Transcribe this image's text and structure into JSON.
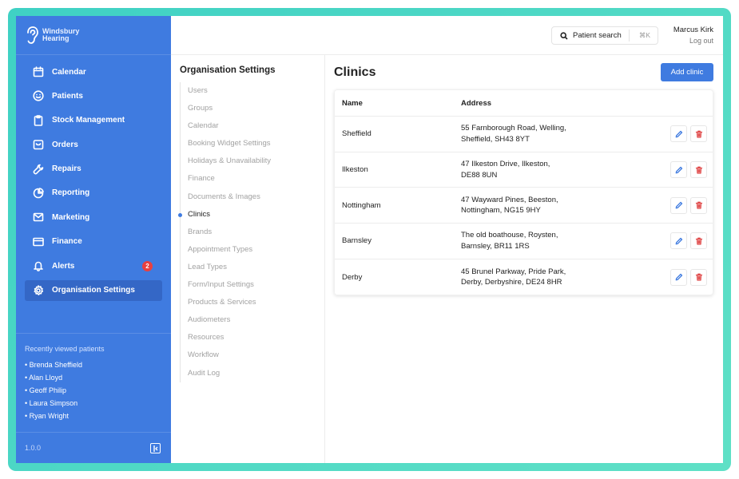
{
  "brand": {
    "line1": "Windsbury",
    "line2": "Hearing"
  },
  "nav": [
    {
      "label": "Calendar",
      "icon": "calendar-icon"
    },
    {
      "label": "Patients",
      "icon": "smile-icon"
    },
    {
      "label": "Stock Management",
      "icon": "clipboard-icon"
    },
    {
      "label": "Orders",
      "icon": "inbox-icon"
    },
    {
      "label": "Repairs",
      "icon": "wrench-icon"
    },
    {
      "label": "Reporting",
      "icon": "pie-chart-icon"
    },
    {
      "label": "Marketing",
      "icon": "mail-icon"
    },
    {
      "label": "Finance",
      "icon": "credit-card-icon"
    },
    {
      "label": "Alerts",
      "icon": "bell-icon",
      "badge": "2"
    },
    {
      "label": "Organisation Settings",
      "icon": "gear-icon",
      "active": true
    }
  ],
  "recent": {
    "title": "Recently viewed patients",
    "patients": [
      "• Brenda Sheffield",
      "• Alan Lloyd",
      "• Geoff Philip",
      "• Laura Simpson",
      "• Ryan Wright"
    ]
  },
  "version": "1.0.0",
  "topbar": {
    "search_label": "Patient search",
    "search_shortcut": "⌘K",
    "user_name": "Marcus Kirk",
    "logout_label": "Log out"
  },
  "settings": {
    "title": "Organisation Settings",
    "items": [
      "Users",
      "Groups",
      "Calendar",
      "Booking Widget Settings",
      "Holidays & Unavailability",
      "Finance",
      "Documents & Images",
      "Clinics",
      "Brands",
      "Appointment Types",
      "Lead Types",
      "Form/Input Settings",
      "Products & Services",
      "Audiometers",
      "Resources",
      "Workflow",
      "Audit Log"
    ],
    "active_index": 7
  },
  "clinics": {
    "title": "Clinics",
    "add_label": "Add clinic",
    "columns": {
      "name": "Name",
      "address": "Address"
    },
    "rows": [
      {
        "name": "Sheffield",
        "address1": "55 Farnborough Road, Welling,",
        "address2": "Sheffield, SH43 8YT"
      },
      {
        "name": "Ilkeston",
        "address1": "47 Ilkeston Drive, Ilkeston,",
        "address2": "DE88 8UN"
      },
      {
        "name": "Nottingham",
        "address1": "47 Wayward Pines, Beeston,",
        "address2": "Nottingham, NG15 9HY"
      },
      {
        "name": "Barnsley",
        "address1": "The old boathouse, Roysten,",
        "address2": "Barnsley, BR11 1RS"
      },
      {
        "name": "Derby",
        "address1": "45 Brunel Parkway, Pride Park,",
        "address2": "Derby, Derbyshire, DE24 8HR"
      }
    ]
  },
  "colors": {
    "primary": "#3f7be0",
    "sidebar": "#3f7be0",
    "active": "#3467c6",
    "danger": "#e04a4a",
    "frame": "#3fd1c4"
  }
}
